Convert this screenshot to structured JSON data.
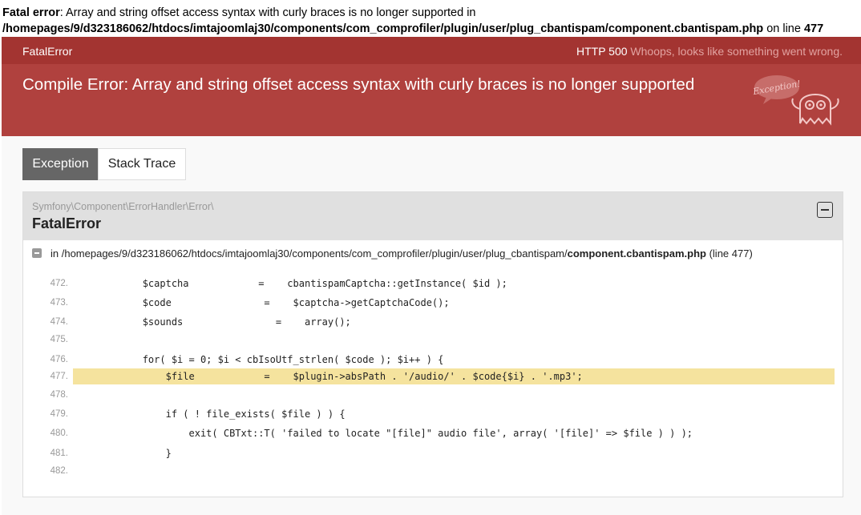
{
  "php_error": {
    "label": "Fatal error",
    "message": ": Array and string offset access syntax with curly braces is no longer supported in",
    "path": "/homepages/9/d323186062/htdocs/imtajoomlaj30/components/com_comprofiler/plugin/user/plug_cbantispam/component.cbantispam.php",
    "on_line": " on line ",
    "line": "477"
  },
  "header": {
    "class_name": "FatalError",
    "status_code": "HTTP 500",
    "status_text": "Whoops, looks like something went wrong.",
    "title": "Compile Error: Array and string offset access syntax with curly braces is no longer supported",
    "mascot_text": "Exception!"
  },
  "tabs": [
    {
      "label": "Exception",
      "active": true
    },
    {
      "label": "Stack Trace",
      "active": false
    }
  ],
  "exception": {
    "namespace": "Symfony\\Component\\ErrorHandler\\Error\\",
    "class": "FatalError",
    "file_prefix": "in ",
    "file_dir": "/homepages/9/d323186062/htdocs/imtajoomlaj30/components/com_comprofiler/plugin/user/plug_cbantispam/",
    "file_name": "component.cbantispam.php",
    "file_line": "(line 477)"
  },
  "code": {
    "highlight_line": "477.",
    "lines": [
      {
        "num": "472.",
        "text": "            $captcha            =    cbantispamCaptcha::getInstance( $id );"
      },
      {
        "num": "473.",
        "text": "            $code                =    $captcha->getCaptchaCode();"
      },
      {
        "num": "474.",
        "text": "            $sounds                =    array();"
      },
      {
        "num": "475.",
        "text": ""
      },
      {
        "num": "476.",
        "text": "            for( $i = 0; $i < cbIsoUtf_strlen( $code ); $i++ ) {"
      },
      {
        "num": "477.",
        "text": "                $file            =    $plugin->absPath . '/audio/' . $code{$i} . '.mp3';"
      },
      {
        "num": "478.",
        "text": ""
      },
      {
        "num": "479.",
        "text": "                if ( ! file_exists( $file ) ) {"
      },
      {
        "num": "480.",
        "text": "                    exit( CBTxt::T( 'failed to locate \"[file]\" audio file', array( '[file]' => $file ) ) );"
      },
      {
        "num": "481.",
        "text": "                }"
      },
      {
        "num": "482.",
        "text": ""
      }
    ]
  }
}
